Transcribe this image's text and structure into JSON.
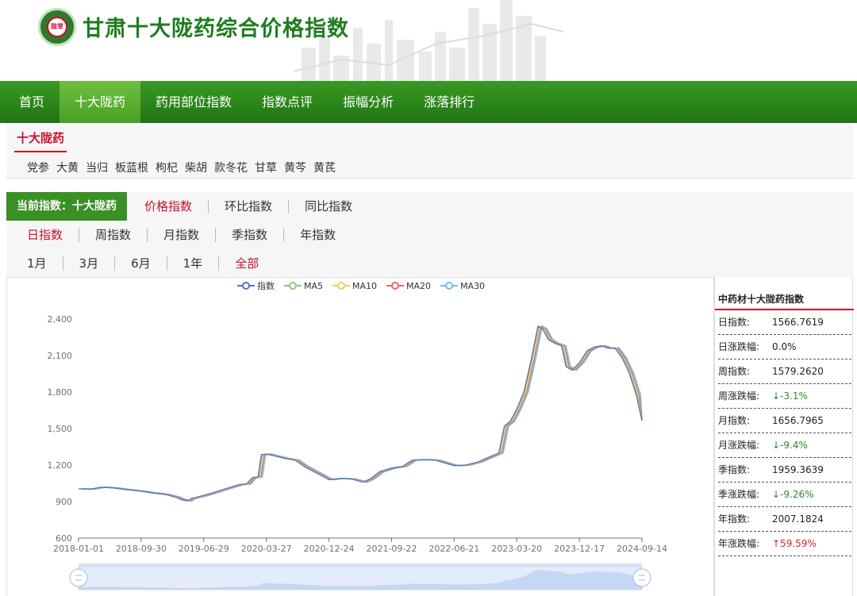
{
  "site": {
    "title": "甘肃十大陇药综合价格指数",
    "logo_text": "陇草源"
  },
  "nav": [
    "首页",
    "十大陇药",
    "药用部位指数",
    "指数点评",
    "振幅分析",
    "涨落排行"
  ],
  "nav_active": 1,
  "category": {
    "title": "十大陇药",
    "items": [
      "党参",
      "大黄",
      "当归",
      "板蓝根",
      "枸杞",
      "柴胡",
      "款冬花",
      "甘草",
      "黄芩",
      "黄芪"
    ]
  },
  "filters": {
    "current_label": "当前指数：十大陇药",
    "index_types": [
      "价格指数",
      "环比指数",
      "同比指数"
    ],
    "index_selected": 0,
    "periods": [
      "日指数",
      "周指数",
      "月指数",
      "季指数",
      "年指数"
    ],
    "period_selected": 0,
    "ranges": [
      "1月",
      "3月",
      "6月",
      "1年",
      "全部"
    ],
    "range_selected": 4
  },
  "side": {
    "title": "中药材十大陇药指数",
    "rows": [
      {
        "label": "日指数:",
        "value": "1566.7619",
        "dir": ""
      },
      {
        "label": "日涨跌幅:",
        "value": "0.0%",
        "dir": ""
      },
      {
        "label": "周指数:",
        "value": "1579.2620",
        "dir": ""
      },
      {
        "label": "周涨跌幅:",
        "value": "↓-3.1%",
        "dir": "down"
      },
      {
        "label": "月指数:",
        "value": "1656.7965",
        "dir": ""
      },
      {
        "label": "月涨跌幅:",
        "value": "↓-9.4%",
        "dir": "down"
      },
      {
        "label": "季指数:",
        "value": "1959.3639",
        "dir": ""
      },
      {
        "label": "季涨跌幅:",
        "value": "↓-9.26%",
        "dir": "down"
      },
      {
        "label": "年指数:",
        "value": "2007.1824",
        "dir": ""
      },
      {
        "label": "年涨跌幅:",
        "value": "↑59.59%",
        "dir": "up"
      }
    ]
  },
  "colors": {
    "green_nav": "#2b8a1c",
    "accent_red": "#c8102e",
    "series": [
      "#5470c6",
      "#91cc75",
      "#fac858",
      "#ee6666",
      "#73c0de"
    ]
  },
  "chart_data": {
    "type": "line",
    "series_names": [
      "指数",
      "MA5",
      "MA10",
      "MA20",
      "MA30"
    ],
    "x_ticks": [
      "2018-01-01",
      "2018-09-30",
      "2019-06-29",
      "2020-03-27",
      "2020-12-24",
      "2021-09-22",
      "2022-06-21",
      "2023-03-20",
      "2023-12-17",
      "2024-09-14"
    ],
    "ylim": [
      600,
      2400
    ],
    "y_ticks": [
      "600",
      "900",
      "1,200",
      "1,500",
      "1,800",
      "2,100",
      "2,400"
    ],
    "index_points": [
      [
        "2018-01-01",
        1005
      ],
      [
        "2018-02-20",
        1002
      ],
      [
        "2018-04-10",
        1018
      ],
      [
        "2018-06-01",
        1012
      ],
      [
        "2018-07-20",
        1000
      ],
      [
        "2018-09-30",
        985
      ],
      [
        "2018-11-20",
        970
      ],
      [
        "2019-01-10",
        960
      ],
      [
        "2019-02-28",
        935
      ],
      [
        "2019-03-25",
        915
      ],
      [
        "2019-04-20",
        905
      ],
      [
        "2019-05-05",
        925
      ],
      [
        "2019-06-29",
        950
      ],
      [
        "2019-08-20",
        980
      ],
      [
        "2019-10-10",
        1010
      ],
      [
        "2019-12-01",
        1040
      ],
      [
        "2020-01-01",
        1045
      ],
      [
        "2020-01-25",
        1095
      ],
      [
        "2020-02-20",
        1105
      ],
      [
        "2020-03-05",
        1285
      ],
      [
        "2020-03-27",
        1290
      ],
      [
        "2020-05-01",
        1275
      ],
      [
        "2020-06-15",
        1255
      ],
      [
        "2020-07-30",
        1240
      ],
      [
        "2020-09-10",
        1185
      ],
      [
        "2020-10-25",
        1140
      ],
      [
        "2020-12-24",
        1080
      ],
      [
        "2021-02-10",
        1090
      ],
      [
        "2021-04-01",
        1085
      ],
      [
        "2021-05-20",
        1060
      ],
      [
        "2021-06-20",
        1085
      ],
      [
        "2021-08-01",
        1145
      ],
      [
        "2021-09-22",
        1175
      ],
      [
        "2021-11-10",
        1190
      ],
      [
        "2021-12-20",
        1240
      ],
      [
        "2022-02-10",
        1245
      ],
      [
        "2022-04-01",
        1240
      ],
      [
        "2022-06-21",
        1195
      ],
      [
        "2022-08-10",
        1200
      ],
      [
        "2022-10-01",
        1225
      ],
      [
        "2022-11-20",
        1265
      ],
      [
        "2023-01-01",
        1300
      ],
      [
        "2023-01-25",
        1520
      ],
      [
        "2023-02-20",
        1560
      ],
      [
        "2023-03-20",
        1660
      ],
      [
        "2023-04-20",
        1800
      ],
      [
        "2023-05-20",
        2050
      ],
      [
        "2023-06-20",
        2340
      ],
      [
        "2023-07-10",
        2320
      ],
      [
        "2023-08-05",
        2230
      ],
      [
        "2023-09-01",
        2200
      ],
      [
        "2023-10-01",
        2180
      ],
      [
        "2023-10-20",
        2010
      ],
      [
        "2023-11-15",
        1980
      ],
      [
        "2023-12-17",
        2040
      ],
      [
        "2024-01-20",
        2140
      ],
      [
        "2024-02-20",
        2170
      ],
      [
        "2024-03-20",
        2180
      ],
      [
        "2024-04-20",
        2160
      ],
      [
        "2024-05-20",
        2160
      ],
      [
        "2024-06-20",
        2080
      ],
      [
        "2024-07-20",
        1960
      ],
      [
        "2024-08-20",
        1780
      ],
      [
        "2024-09-14",
        1566.7619
      ]
    ],
    "xlabel": "",
    "ylabel": "",
    "legend_position": "top-center",
    "grid": false
  }
}
